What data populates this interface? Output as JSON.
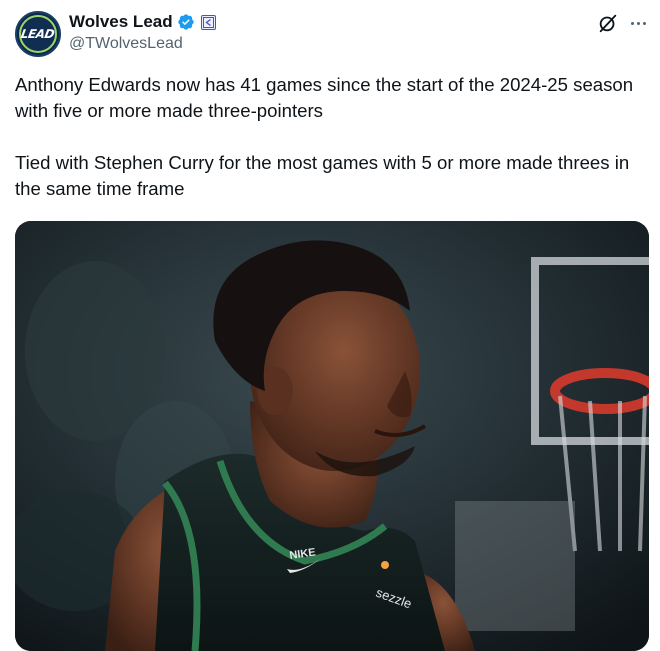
{
  "author": {
    "display_name": "Wolves Lead",
    "handle": "@TWolvesLead",
    "avatar_text": "LEAD",
    "verified": true,
    "affiliate_badge": true
  },
  "icons": {
    "grok": "grok-icon",
    "more": "more-options-icon",
    "verified": "verified-badge-icon",
    "affiliate": "affiliate-badge-icon"
  },
  "tweet": {
    "paragraphs": [
      "Anthony Edwards now has 41 games since the start of the 2024-25 season with five or more made three-pointers",
      "Tied with Stephen Curry for the most games with 5 or more made threes in the same time frame"
    ]
  },
  "media": {
    "jersey_brand": "NIKE",
    "jersey_sponsor": "sezzle"
  },
  "colors": {
    "text_primary": "#0f1419",
    "text_secondary": "#536471",
    "verified_blue": "#1d9bf0",
    "jersey_green": "#2f7a4f"
  }
}
